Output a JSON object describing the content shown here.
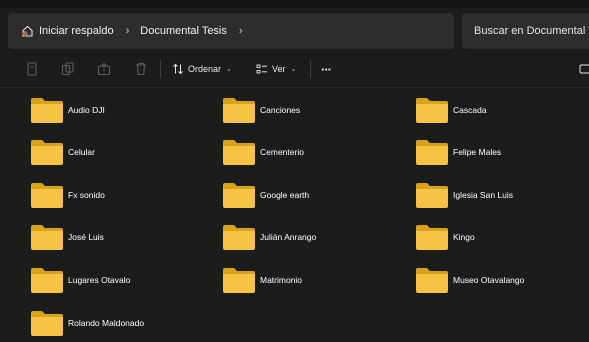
{
  "address_bar": {
    "home_label": "Iniciar respaldo",
    "folder_label": "Documental Tesis"
  },
  "search": {
    "placeholder": "Buscar en Documental Tesis"
  },
  "toolbar": {
    "sort_label": "Ordenar",
    "view_label": "Ver",
    "more_label": "···"
  },
  "folders": [
    "Audio DJI",
    "Canciones",
    "Cascada",
    "Celular",
    "Cementerio",
    "Felipe Males",
    "Fx sonido",
    "Google earth",
    "Iglesia San Luis",
    "José Luis",
    "Julián Anrango",
    "Kingo",
    "Lugares Otavalo",
    "Matrimonio",
    "Museo Otavalango",
    "Rolando Maldonado"
  ],
  "colors": {
    "background": "#1c1c1c",
    "folder_yellow": "#f5c444",
    "folder_back": "#d9a21c",
    "bar_bg": "#2d2d2d"
  }
}
